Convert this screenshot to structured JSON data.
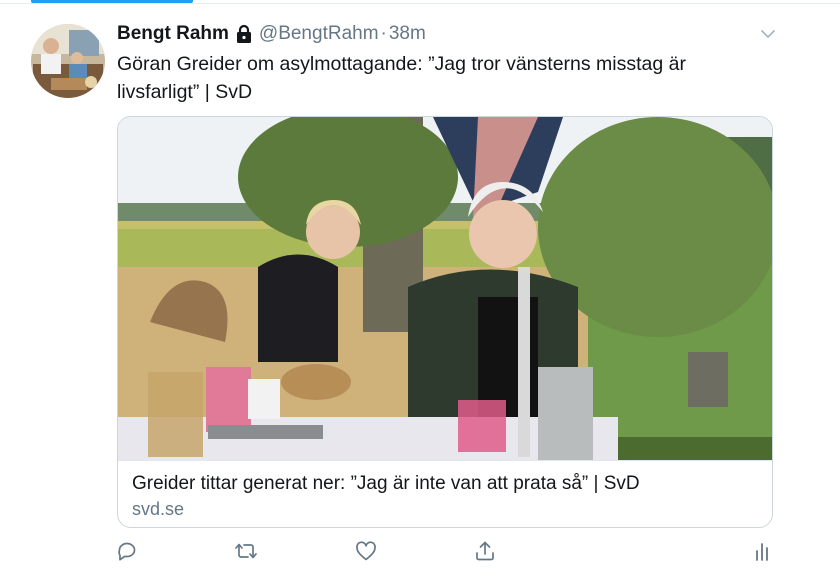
{
  "tweet": {
    "display_name": "Bengt Rahm",
    "handle": "@BengtRahm",
    "separator": "·",
    "time": "38m",
    "text_line1": "Göran Greider om asylmottagande: ”Jag tror vänsterns misstag är",
    "text_line2": "livsfarligt” | SvD"
  },
  "card": {
    "title": "Greider tittar generat ner: ”Jag är inte van att prata så” | SvD",
    "domain": "svd.se"
  },
  "icons": {
    "lock": "lock-icon",
    "caret": "chevron-down-icon",
    "reply": "reply-icon",
    "retweet": "retweet-icon",
    "like": "heart-icon",
    "share": "share-icon",
    "analytics": "analytics-icon"
  },
  "colors": {
    "accent": "#1da1f2",
    "text": "#14171a",
    "secondary": "#657786",
    "border": "#ccd6dd"
  }
}
